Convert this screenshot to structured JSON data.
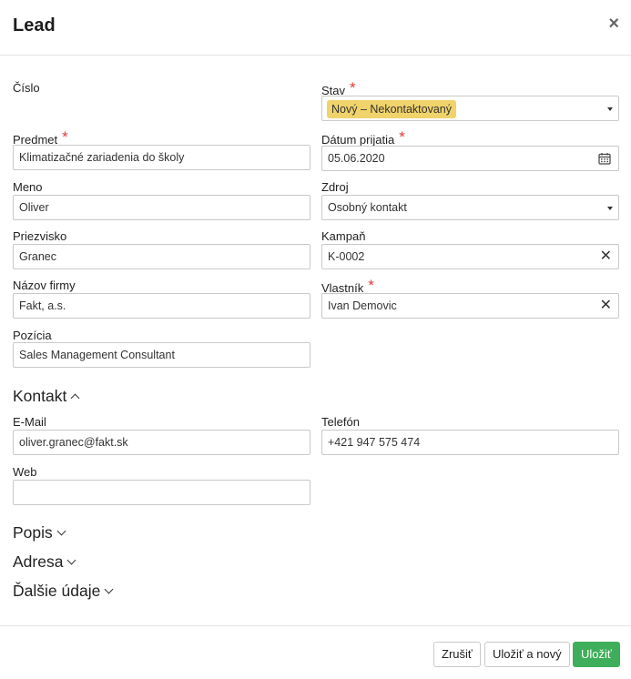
{
  "dialog": {
    "title": "Lead",
    "close_label": "×"
  },
  "fields": {
    "cislo_label": "Číslo",
    "stav_label": "Stav",
    "stav_value": "Nový – Nekontaktovaný",
    "predmet_label": "Predmet",
    "predmet_value": "Klimatizačné zariadenia do školy",
    "datum_label": "Dátum prijatia",
    "datum_value": "05.06.2020",
    "meno_label": "Meno",
    "meno_value": "Oliver",
    "zdroj_label": "Zdroj",
    "zdroj_value": "Osobný kontakt",
    "priezvisko_label": "Priezvisko",
    "priezvisko_value": "Granec",
    "kampan_label": "Kampaň",
    "kampan_value": "K-0002",
    "firma_label": "Názov firmy",
    "firma_value": "Fakt, a.s.",
    "vlastnik_label": "Vlastník",
    "vlastnik_value": "Ivan Demovic",
    "pozicia_label": "Pozícia",
    "pozicia_value": "Sales Management Consultant",
    "required_mark": "*"
  },
  "kontakt": {
    "title": "Kontakt",
    "email_label": "E-Mail",
    "email_value": "oliver.granec@fakt.sk",
    "telefon_label": "Telefón",
    "telefon_value": "+421 947 575 474",
    "web_label": "Web",
    "web_value": ""
  },
  "sections": {
    "popis": "Popis",
    "adresa": "Adresa",
    "dalsie": "Ďalšie údaje"
  },
  "footer": {
    "cancel": "Zrušiť",
    "save_new": "Uložiť a nový",
    "save": "Uložiť"
  },
  "colors": {
    "badge": "#f0d36a",
    "primary": "#3fae5a",
    "required": "#e53935"
  },
  "icons": {
    "close": "close-icon",
    "dropdown": "caret-down-icon",
    "clear": "clear-icon",
    "calendar": "calendar-icon",
    "chevron_up": "chevron-up-icon",
    "chevron_down": "chevron-down-icon"
  }
}
